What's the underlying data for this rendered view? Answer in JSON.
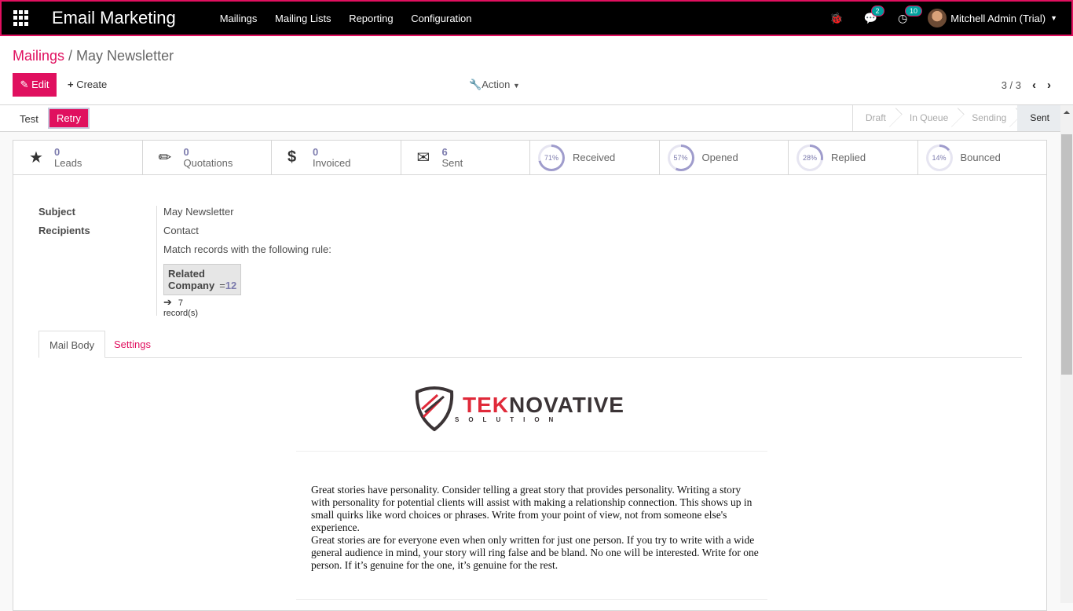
{
  "navbar": {
    "app_title": "Email Marketing",
    "menu": [
      "Mailings",
      "Mailing Lists",
      "Reporting",
      "Configuration"
    ],
    "messages_count": "2",
    "activities_count": "10",
    "user": "Mitchell Admin (Trial)"
  },
  "breadcrumb": {
    "parent": "Mailings",
    "current": "May Newsletter"
  },
  "toolbar": {
    "edit": "Edit",
    "create": "Create",
    "action": "Action",
    "pager": "3 / 3"
  },
  "statusbar": {
    "test": "Test",
    "retry": "Retry",
    "stages": [
      "Draft",
      "In Queue",
      "Sending",
      "Sent"
    ],
    "active_stage": "Sent"
  },
  "stats": [
    {
      "value": "0",
      "label": "Leads"
    },
    {
      "value": "0",
      "label": "Quotations"
    },
    {
      "value": "0",
      "label": "Invoiced"
    },
    {
      "value": "6",
      "label": "Sent"
    }
  ],
  "pies": [
    {
      "percent": 71,
      "text": "71%",
      "label": "Received"
    },
    {
      "percent": 57,
      "text": "57%",
      "label": "Opened"
    },
    {
      "percent": 28,
      "text": "28%",
      "label": "Replied"
    },
    {
      "percent": 14,
      "text": "14%",
      "label": "Bounced"
    }
  ],
  "colors": {
    "accent": "#e0105f",
    "pie": "#9f9ccc",
    "pie_bg": "#e6e5f1"
  },
  "form": {
    "subject_label": "Subject",
    "subject": "May Newsletter",
    "recipients_label": "Recipients",
    "recipients": "Contact",
    "rule_intro": "Match records with the following rule:",
    "rule_field": "Related Company",
    "rule_op": "=",
    "rule_value": "12",
    "records": "7 record(s)"
  },
  "tabs": [
    "Mail Body",
    "Settings"
  ],
  "logo": {
    "brand_red": "TEK",
    "brand_dark": "NOVATIVE",
    "sub": "SOLUTION"
  },
  "mail_body": [
    "Great stories have personality. Consider telling a great story that provides personality. Writing a story with personality for potential clients will assist with making a relationship connection. This shows up in small quirks like word choices or phrases. Write from your point of view, not from someone else's experience.",
    "Great stories are for everyone even when only written for just one person. If you try to write with a wide general audience in mind, your story will ring false and be bland. No one will be interested. Write for one person. If it’s genuine for the one, it’s genuine for the rest."
  ]
}
